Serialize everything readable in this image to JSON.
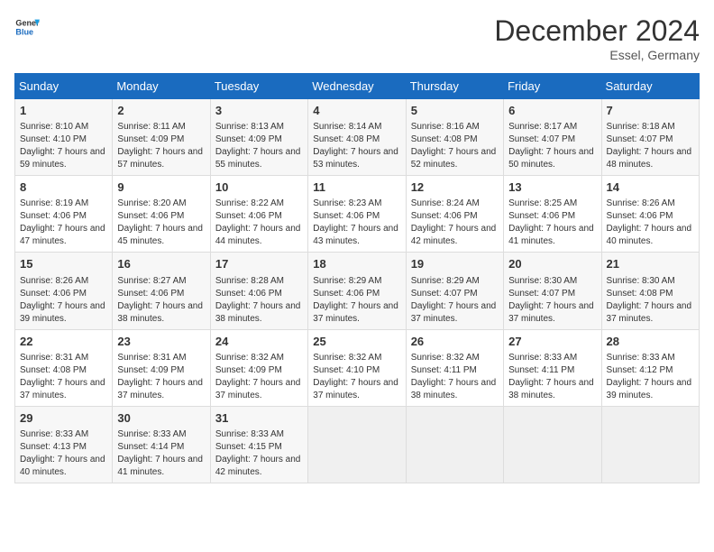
{
  "header": {
    "logo_general": "General",
    "logo_blue": "Blue",
    "month_year": "December 2024",
    "location": "Essel, Germany"
  },
  "weekdays": [
    "Sunday",
    "Monday",
    "Tuesday",
    "Wednesday",
    "Thursday",
    "Friday",
    "Saturday"
  ],
  "weeks": [
    [
      {
        "day": "1",
        "sunrise": "8:10 AM",
        "sunset": "4:10 PM",
        "daylight": "7 hours and 59 minutes."
      },
      {
        "day": "2",
        "sunrise": "8:11 AM",
        "sunset": "4:09 PM",
        "daylight": "7 hours and 57 minutes."
      },
      {
        "day": "3",
        "sunrise": "8:13 AM",
        "sunset": "4:09 PM",
        "daylight": "7 hours and 55 minutes."
      },
      {
        "day": "4",
        "sunrise": "8:14 AM",
        "sunset": "4:08 PM",
        "daylight": "7 hours and 53 minutes."
      },
      {
        "day": "5",
        "sunrise": "8:16 AM",
        "sunset": "4:08 PM",
        "daylight": "7 hours and 52 minutes."
      },
      {
        "day": "6",
        "sunrise": "8:17 AM",
        "sunset": "4:07 PM",
        "daylight": "7 hours and 50 minutes."
      },
      {
        "day": "7",
        "sunrise": "8:18 AM",
        "sunset": "4:07 PM",
        "daylight": "7 hours and 48 minutes."
      }
    ],
    [
      {
        "day": "8",
        "sunrise": "8:19 AM",
        "sunset": "4:06 PM",
        "daylight": "7 hours and 47 minutes."
      },
      {
        "day": "9",
        "sunrise": "8:20 AM",
        "sunset": "4:06 PM",
        "daylight": "7 hours and 45 minutes."
      },
      {
        "day": "10",
        "sunrise": "8:22 AM",
        "sunset": "4:06 PM",
        "daylight": "7 hours and 44 minutes."
      },
      {
        "day": "11",
        "sunrise": "8:23 AM",
        "sunset": "4:06 PM",
        "daylight": "7 hours and 43 minutes."
      },
      {
        "day": "12",
        "sunrise": "8:24 AM",
        "sunset": "4:06 PM",
        "daylight": "7 hours and 42 minutes."
      },
      {
        "day": "13",
        "sunrise": "8:25 AM",
        "sunset": "4:06 PM",
        "daylight": "7 hours and 41 minutes."
      },
      {
        "day": "14",
        "sunrise": "8:26 AM",
        "sunset": "4:06 PM",
        "daylight": "7 hours and 40 minutes."
      }
    ],
    [
      {
        "day": "15",
        "sunrise": "8:26 AM",
        "sunset": "4:06 PM",
        "daylight": "7 hours and 39 minutes."
      },
      {
        "day": "16",
        "sunrise": "8:27 AM",
        "sunset": "4:06 PM",
        "daylight": "7 hours and 38 minutes."
      },
      {
        "day": "17",
        "sunrise": "8:28 AM",
        "sunset": "4:06 PM",
        "daylight": "7 hours and 38 minutes."
      },
      {
        "day": "18",
        "sunrise": "8:29 AM",
        "sunset": "4:06 PM",
        "daylight": "7 hours and 37 minutes."
      },
      {
        "day": "19",
        "sunrise": "8:29 AM",
        "sunset": "4:07 PM",
        "daylight": "7 hours and 37 minutes."
      },
      {
        "day": "20",
        "sunrise": "8:30 AM",
        "sunset": "4:07 PM",
        "daylight": "7 hours and 37 minutes."
      },
      {
        "day": "21",
        "sunrise": "8:30 AM",
        "sunset": "4:08 PM",
        "daylight": "7 hours and 37 minutes."
      }
    ],
    [
      {
        "day": "22",
        "sunrise": "8:31 AM",
        "sunset": "4:08 PM",
        "daylight": "7 hours and 37 minutes."
      },
      {
        "day": "23",
        "sunrise": "8:31 AM",
        "sunset": "4:09 PM",
        "daylight": "7 hours and 37 minutes."
      },
      {
        "day": "24",
        "sunrise": "8:32 AM",
        "sunset": "4:09 PM",
        "daylight": "7 hours and 37 minutes."
      },
      {
        "day": "25",
        "sunrise": "8:32 AM",
        "sunset": "4:10 PM",
        "daylight": "7 hours and 37 minutes."
      },
      {
        "day": "26",
        "sunrise": "8:32 AM",
        "sunset": "4:11 PM",
        "daylight": "7 hours and 38 minutes."
      },
      {
        "day": "27",
        "sunrise": "8:33 AM",
        "sunset": "4:11 PM",
        "daylight": "7 hours and 38 minutes."
      },
      {
        "day": "28",
        "sunrise": "8:33 AM",
        "sunset": "4:12 PM",
        "daylight": "7 hours and 39 minutes."
      }
    ],
    [
      {
        "day": "29",
        "sunrise": "8:33 AM",
        "sunset": "4:13 PM",
        "daylight": "7 hours and 40 minutes."
      },
      {
        "day": "30",
        "sunrise": "8:33 AM",
        "sunset": "4:14 PM",
        "daylight": "7 hours and 41 minutes."
      },
      {
        "day": "31",
        "sunrise": "8:33 AM",
        "sunset": "4:15 PM",
        "daylight": "7 hours and 42 minutes."
      },
      null,
      null,
      null,
      null
    ]
  ],
  "labels": {
    "sunrise": "Sunrise:",
    "sunset": "Sunset:",
    "daylight": "Daylight:"
  }
}
